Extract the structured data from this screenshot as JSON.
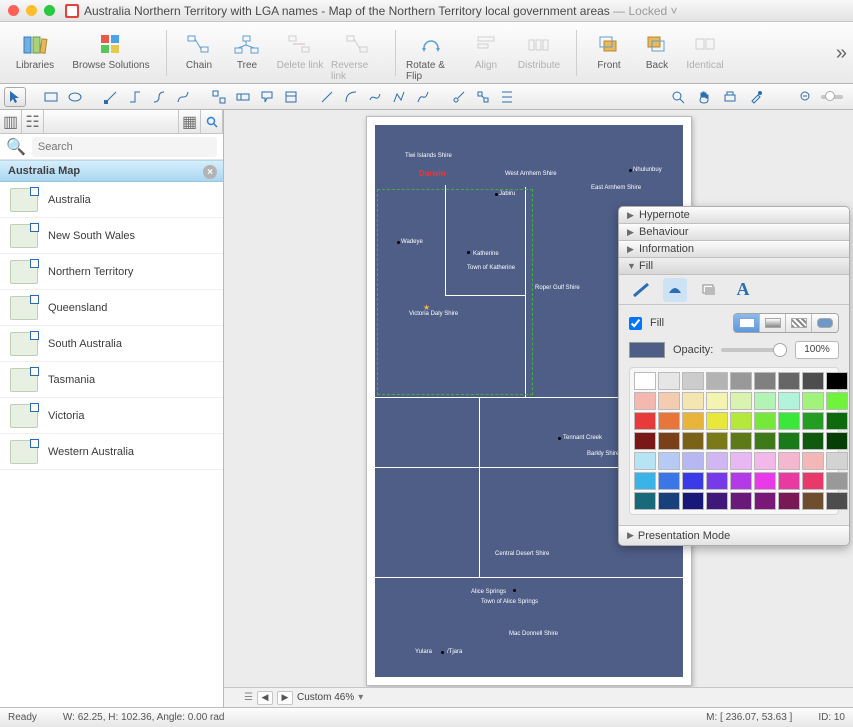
{
  "title": {
    "doc_name": "Australia Northern Territory with LGA names",
    "subtitle": "Map of the Northern Territory local government areas",
    "lock_state": "— Locked"
  },
  "toolbar": {
    "libraries": "Libraries",
    "browse_solutions": "Browse Solutions",
    "chain": "Chain",
    "tree": "Tree",
    "delete_link": "Delete link",
    "reverse_link": "Reverse link",
    "rotate_flip": "Rotate & Flip",
    "align": "Align",
    "distribute": "Distribute",
    "front": "Front",
    "back": "Back",
    "identical": "Identical"
  },
  "sidebar": {
    "search_placeholder": "Search",
    "section_title": "Australia Map",
    "items": [
      {
        "label": "Australia"
      },
      {
        "label": "New South Wales"
      },
      {
        "label": "Northern Territory"
      },
      {
        "label": "Queensland"
      },
      {
        "label": "South Australia"
      },
      {
        "label": "Tasmania"
      },
      {
        "label": "Victoria"
      },
      {
        "label": "Western Australia"
      }
    ]
  },
  "map_labels": {
    "darwin": "Darwin",
    "tiwi": "Tiwi Islands Shire",
    "jabiru": "Jabiru",
    "west_arnhem": "West Arnhem Shire",
    "east_arnhem": "East Arnhem Shire",
    "nhulunbuy": "Nhulunbuy",
    "wadeye": "Wadeye",
    "katherine": "Katherine",
    "town_katherine": "Town of Katherine",
    "roper": "Roper Gulf Shire",
    "vic_daly": "Victoria Daly Shire",
    "tennant": "Tennant Creek",
    "barkly": "Barkly Shire",
    "central": "Central Desert Shire",
    "alice": "Alice Springs",
    "town_alice": "Town of Alice Springs",
    "macdonnell": "Mac Donnell Shire",
    "yulara": "Yulara",
    "tjara": "/Tjara"
  },
  "inspector": {
    "hypernote": "Hypernote",
    "behaviour": "Behaviour",
    "information": "Information",
    "fill_section": "Fill",
    "fill_checkbox": "Fill",
    "opacity_label": "Opacity:",
    "opacity_value": "100%",
    "presentation": "Presentation Mode",
    "palette": [
      "#ffffff",
      "#e6e6e6",
      "#cccccc",
      "#b3b3b3",
      "#999999",
      "#808080",
      "#666666",
      "#4d4d4d",
      "#000000",
      "#f4b8b1",
      "#f4cdb1",
      "#f4e5b1",
      "#f4f4b1",
      "#d9f4b1",
      "#b1f4b6",
      "#b1f4db",
      "#a0f47a",
      "#70f43b",
      "#e83a3a",
      "#e8763a",
      "#e8b43a",
      "#e8e83a",
      "#b4e83a",
      "#76e83a",
      "#3ae83a",
      "#239e23",
      "#0d6b0d",
      "#7a1818",
      "#7a4018",
      "#7a6218",
      "#7a7a18",
      "#5e7a18",
      "#3e7a18",
      "#187a18",
      "#0f5a0f",
      "#063f06",
      "#b7e4f4",
      "#b7caf4",
      "#b7b7f4",
      "#d0b7f4",
      "#e9b7f4",
      "#f4b7ea",
      "#f4b7cf",
      "#f4b7b7",
      "#d3d3d3",
      "#3ab4e8",
      "#3a76e8",
      "#3a3ae8",
      "#763ae8",
      "#b43ae8",
      "#e83ae8",
      "#e83aa0",
      "#e83a6a",
      "#999999",
      "#186a7a",
      "#18407a",
      "#18187a",
      "#40187a",
      "#6a187a",
      "#7a187a",
      "#7a1856",
      "#6e4e2e",
      "#4d4d4d"
    ]
  },
  "canvas": {
    "zoom_label": "Custom 46%"
  },
  "status": {
    "ready": "Ready",
    "dims": "W: 62.25,  H: 102.36,  Angle: 0.00 rad",
    "mouse": "M: [ 236.07, 53.63 ]",
    "id": "ID: 10"
  }
}
